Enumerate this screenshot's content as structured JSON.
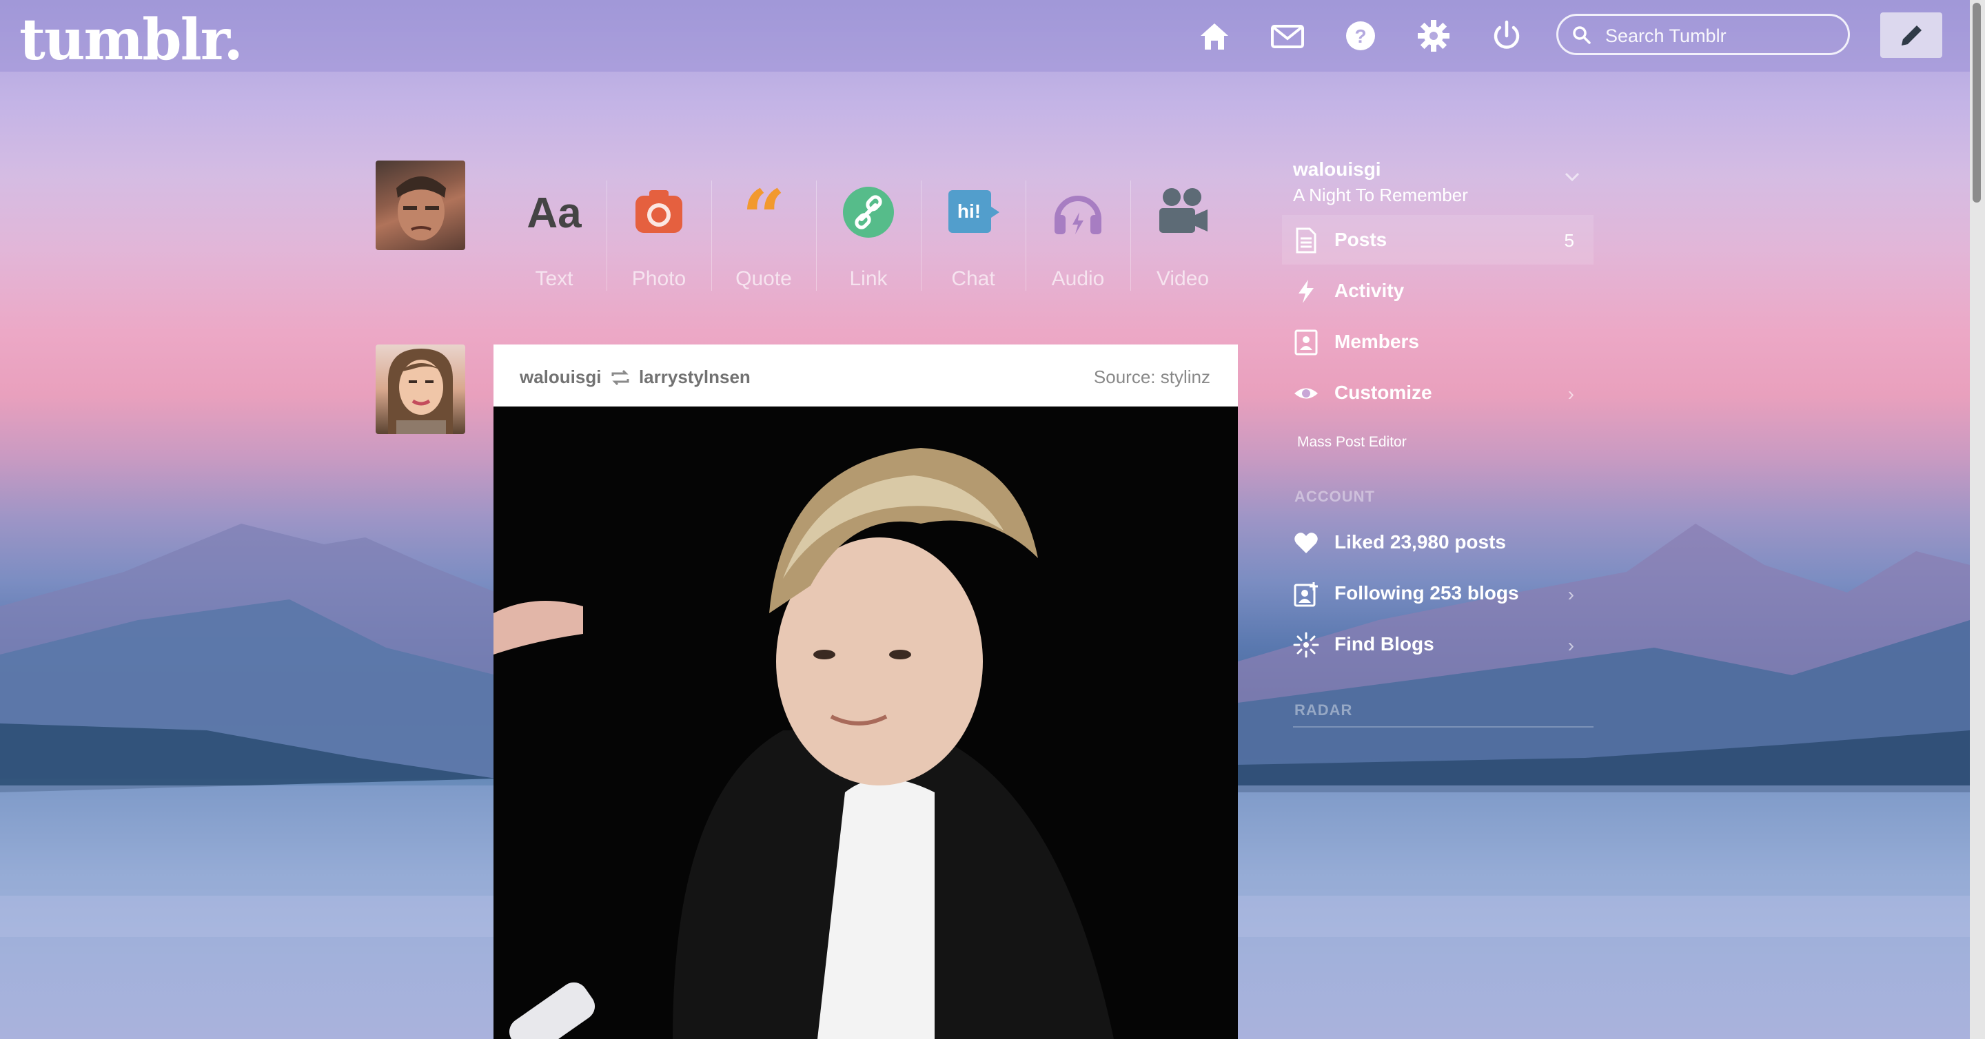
{
  "app": {
    "logo": "tumblr."
  },
  "header": {
    "nav": [
      {
        "name": "home-icon"
      },
      {
        "name": "mail-icon"
      },
      {
        "name": "help-icon"
      },
      {
        "name": "settings-icon"
      },
      {
        "name": "power-icon"
      }
    ],
    "search": {
      "placeholder": "Search Tumblr"
    },
    "compose_icon": "pencil-icon"
  },
  "post_types": [
    {
      "label": "Text",
      "icon": "text-icon",
      "color": "#444444"
    },
    {
      "label": "Photo",
      "icon": "camera-icon",
      "color": "#e5603f"
    },
    {
      "label": "Quote",
      "icon": "quote-icon",
      "color": "#f2992e"
    },
    {
      "label": "Link",
      "icon": "link-icon",
      "color": "#56bc8a"
    },
    {
      "label": "Chat",
      "icon": "chat-icon",
      "color": "#529ecc"
    },
    {
      "label": "Audio",
      "icon": "headphones-icon",
      "color": "#a77dc2"
    },
    {
      "label": "Video",
      "icon": "video-camera-icon",
      "color": "#748089"
    }
  ],
  "post": {
    "author": "walouisgi",
    "reblogged_from": "larrystylnsen",
    "source": "Source: stylinz"
  },
  "sidebar": {
    "blog_name": "walouisgi",
    "blog_title": "A Night To Remember",
    "items": [
      {
        "label": "Posts",
        "count": "5"
      },
      {
        "label": "Activity"
      },
      {
        "label": "Members"
      },
      {
        "label": "Customize"
      }
    ],
    "mass_post_editor": "Mass Post Editor",
    "account_heading": "ACCOUNT",
    "account_items": [
      {
        "label": "Liked 23,980 posts"
      },
      {
        "label": "Following 253 blogs"
      },
      {
        "label": "Find Blogs"
      }
    ],
    "radar_heading": "RADAR"
  },
  "colors": {
    "accent": "#ffffff",
    "sky_top": "#a9a2dd",
    "sky_pink": "#eca8c6",
    "lake": "#6d8fbd"
  }
}
